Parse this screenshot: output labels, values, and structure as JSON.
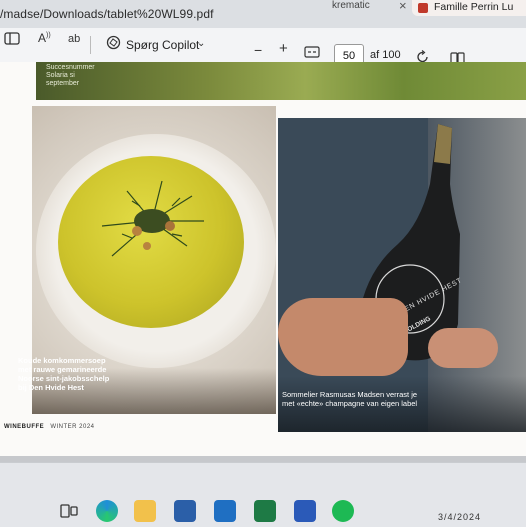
{
  "browser": {
    "url": "/madse/Downloads/tablet%20WL99.pdf",
    "other_tab": "krematic",
    "active_tab": "Famille Perrin Lu"
  },
  "toolbar": {
    "ask_copilot_label": "Spørg Copilot",
    "page_number": "50",
    "page_total": "af 100",
    "zoom_out": "−",
    "zoom_in": "+"
  },
  "pdf": {
    "top_caption": "Succesnummer Solaria si september",
    "soup_caption": "Koude komkommersoep met rauwe gemarineerde Noorse sint-jakobsschelp bij Den Hvide Hest",
    "bottle_caption": "Sommelier Rasmusas Madsen verrast je met «echte» champagne van eigen label",
    "bottle_label_top": "DEN HVIDE HEST",
    "bottle_label_bottom": "KOLDING",
    "footer_brand": "WINEBUFFE",
    "footer_issue": "WINTER 2024"
  },
  "taskbar": {
    "clock": "3/4/2024"
  }
}
